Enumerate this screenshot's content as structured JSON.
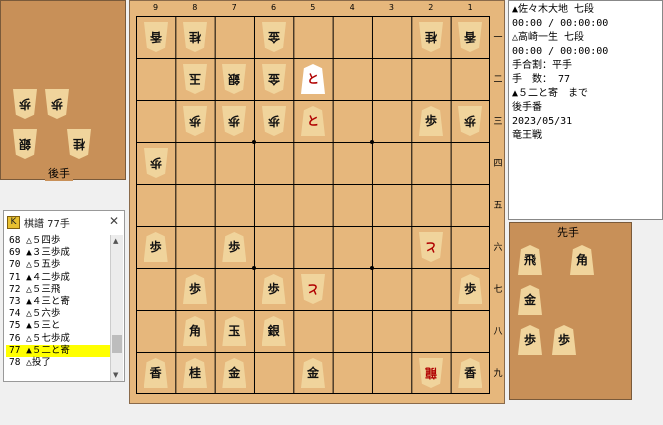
{
  "window": {
    "sente_label": "先手",
    "gote_label": "後手"
  },
  "info": {
    "sente_player": "▲佐々木大地 七段",
    "sente_time": "00:00 / 00:00:00",
    "gote_player": "△高崎一生 七段",
    "gote_time": "00:00 / 00:00:00",
    "handicap": "手合割：平手",
    "move_count": "手　数： 77",
    "last_move": "▲５二と寄　まで",
    "turn": "後手番",
    "date": "2023/05/31",
    "event": "竜王戦"
  },
  "kifu": {
    "title": "棋譜 77手",
    "moves": [
      "68 △５四歩",
      "69 ▲３三歩成",
      "70 △５五歩",
      "71 ▲４二歩成",
      "72 △５三飛",
      "73 ▲４三と寄",
      "74 △５六歩",
      "75 ▲５三と",
      "76 △５七歩成",
      "77 ▲５二と寄",
      "78 △投了"
    ],
    "selected_index": 9
  },
  "board": {
    "file_numbers": [
      "9",
      "8",
      "7",
      "6",
      "5",
      "4",
      "3",
      "2",
      "1"
    ],
    "rank_numbers": [
      "一",
      "二",
      "三",
      "四",
      "五",
      "六",
      "七",
      "八",
      "九"
    ],
    "pieces": [
      {
        "file": 9,
        "rank": 1,
        "owner": "gote",
        "label": "香"
      },
      {
        "file": 8,
        "rank": 1,
        "owner": "gote",
        "label": "桂"
      },
      {
        "file": 6,
        "rank": 1,
        "owner": "gote",
        "label": "金"
      },
      {
        "file": 2,
        "rank": 1,
        "owner": "gote",
        "label": "桂"
      },
      {
        "file": 1,
        "rank": 1,
        "owner": "gote",
        "label": "香"
      },
      {
        "file": 8,
        "rank": 2,
        "owner": "gote",
        "label": "玉"
      },
      {
        "file": 7,
        "rank": 2,
        "owner": "gote",
        "label": "銀"
      },
      {
        "file": 6,
        "rank": 2,
        "owner": "gote",
        "label": "金"
      },
      {
        "file": 5,
        "rank": 2,
        "owner": "sente",
        "label": "と",
        "promoted": true,
        "highlight": true
      },
      {
        "file": 8,
        "rank": 3,
        "owner": "gote",
        "label": "歩"
      },
      {
        "file": 7,
        "rank": 3,
        "owner": "gote",
        "label": "歩"
      },
      {
        "file": 6,
        "rank": 3,
        "owner": "gote",
        "label": "歩"
      },
      {
        "file": 5,
        "rank": 3,
        "owner": "sente",
        "label": "と",
        "promoted": true
      },
      {
        "file": 2,
        "rank": 3,
        "owner": "sente",
        "label": "歩"
      },
      {
        "file": 1,
        "rank": 3,
        "owner": "gote",
        "label": "歩"
      },
      {
        "file": 9,
        "rank": 4,
        "owner": "gote",
        "label": "歩"
      },
      {
        "file": 9,
        "rank": 6,
        "owner": "sente",
        "label": "歩"
      },
      {
        "file": 7,
        "rank": 6,
        "owner": "sente",
        "label": "歩"
      },
      {
        "file": 2,
        "rank": 6,
        "owner": "gote",
        "label": "と",
        "promoted": true
      },
      {
        "file": 8,
        "rank": 7,
        "owner": "sente",
        "label": "歩"
      },
      {
        "file": 6,
        "rank": 7,
        "owner": "sente",
        "label": "歩"
      },
      {
        "file": 5,
        "rank": 7,
        "owner": "gote",
        "label": "と",
        "promoted": true
      },
      {
        "file": 1,
        "rank": 7,
        "owner": "sente",
        "label": "歩"
      },
      {
        "file": 8,
        "rank": 8,
        "owner": "sente",
        "label": "角"
      },
      {
        "file": 7,
        "rank": 8,
        "owner": "sente",
        "label": "玉"
      },
      {
        "file": 6,
        "rank": 8,
        "owner": "sente",
        "label": "銀"
      },
      {
        "file": 9,
        "rank": 9,
        "owner": "sente",
        "label": "香"
      },
      {
        "file": 8,
        "rank": 9,
        "owner": "sente",
        "label": "桂"
      },
      {
        "file": 7,
        "rank": 9,
        "owner": "sente",
        "label": "金"
      },
      {
        "file": 5,
        "rank": 9,
        "owner": "sente",
        "label": "金"
      },
      {
        "file": 2,
        "rank": 9,
        "owner": "gote",
        "label": "龍",
        "promoted": true
      },
      {
        "file": 1,
        "rank": 9,
        "owner": "sente",
        "label": "香"
      }
    ]
  },
  "hands": {
    "gote": [
      {
        "label": "歩"
      },
      {
        "label": "歩"
      },
      {
        "label": "銀"
      },
      {
        "label": "桂"
      }
    ],
    "sente": [
      {
        "label": "飛"
      },
      {
        "label": "角"
      },
      {
        "label": "金"
      },
      {
        "label": "歩"
      },
      {
        "label": "歩"
      }
    ]
  },
  "colors": {
    "board": "#e6b77c",
    "hand": "#c89058",
    "piece": "#f0d49c",
    "selected": "#ffff00"
  }
}
